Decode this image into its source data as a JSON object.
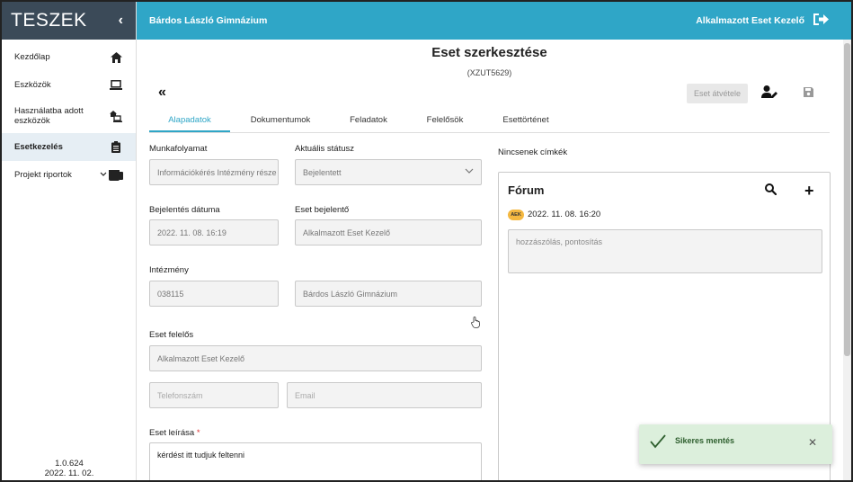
{
  "sidebar": {
    "logo": "TESZEK",
    "collapse": "‹",
    "items": [
      {
        "label": "Kezdőlap",
        "icon": "home-icon"
      },
      {
        "label": "Eszközök",
        "icon": "laptop-icon"
      },
      {
        "label": "Használatba adott eszközök",
        "icon": "device-share-icon"
      },
      {
        "label": "Esetkezelés",
        "icon": "clipboard-icon"
      },
      {
        "label": "Projekt riportok",
        "icon": "report-icon"
      }
    ],
    "version": "1.0.624",
    "version_date": "2022. 11. 02."
  },
  "topbar": {
    "organization": "Bárdos László Gimnázium",
    "user": "Alkalmazott Eset Kezelő",
    "logout_icon": "logout-icon"
  },
  "page": {
    "title": "Eset szerkesztése",
    "case_id": "(XZUT5629)",
    "back_label": "«",
    "take_button": "Eset átvétele"
  },
  "tabs": [
    "Alapadatok",
    "Dokumentumok",
    "Feladatok",
    "Felelősök",
    "Esettörténet"
  ],
  "form": {
    "workflow_label": "Munkafolyamat",
    "workflow_value": "Információkérés Intézmény része",
    "status_label": "Aktuális státusz",
    "status_value": "Bejelentett",
    "report_date_label": "Bejelentés dátuma",
    "report_date_value": "2022. 11. 08. 16:19",
    "reporter_label": "Eset bejelentő",
    "reporter_value": "Alkalmazott Eset Kezelő",
    "institution_label": "Intézmény",
    "institution_code": "038115",
    "institution_name": "Bárdos László Gimnázium",
    "owner_label": "Eset felelős",
    "owner_value": "Alkalmazott Eset Kezelő",
    "phone_placeholder": "Telefonszám",
    "email_placeholder": "Email",
    "description_label": "Eset leírása",
    "required_mark": "*",
    "description_value": "kérdést itt tudjuk feltenni"
  },
  "tags": {
    "empty_text": "Nincsenek címkék"
  },
  "forum": {
    "title": "Fórum",
    "add_label": "+",
    "badge": "AEK",
    "date": "2022. 11. 08. 16:20",
    "comment_placeholder": "hozzászólás, pontosítás"
  },
  "toast": {
    "message": "Sikeres mentés",
    "close": "✕"
  },
  "colors": {
    "topbar": "#2fa6c7",
    "logo_bar": "#3b4a58",
    "active_nav": "#e6eef4",
    "toast_bg": "#dcefdc",
    "badge": "#f4b841"
  }
}
